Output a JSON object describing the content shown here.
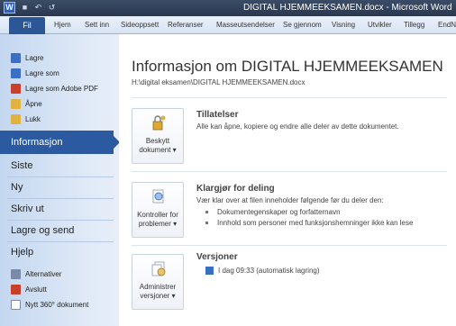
{
  "window": {
    "title": "DIGITAL HJEMMEEKSAMEN.docx - Microsoft Word",
    "logo": "W"
  },
  "quick_access": [
    {
      "icon": "save-icon",
      "glyph": "■"
    },
    {
      "icon": "undo-icon",
      "glyph": "↶"
    },
    {
      "icon": "redo-icon",
      "glyph": "↺"
    }
  ],
  "ribbon": {
    "file_tab": "Fil",
    "tabs": [
      "Hjem",
      "Sett inn",
      "Sideoppsett",
      "Referanser",
      "Masseutsendelser",
      "Se gjennom",
      "Visning",
      "Utvikler",
      "Tillegg",
      "EndN"
    ]
  },
  "sidebar": {
    "top_items": [
      {
        "label": "Lagre",
        "icon": "save-icon",
        "color": "#3a6fc2"
      },
      {
        "label": "Lagre som",
        "icon": "save-as-icon",
        "color": "#3a6fc2"
      },
      {
        "label": "Lagre som Adobe PDF",
        "icon": "pdf-icon",
        "color": "#c8402b"
      },
      {
        "label": "Åpne",
        "icon": "open-folder-icon",
        "color": "#e0b240"
      },
      {
        "label": "Lukk",
        "icon": "close-folder-icon",
        "color": "#e0b240"
      }
    ],
    "selected": "Informasjon",
    "main_items": [
      "Siste",
      "Ny",
      "Skriv ut",
      "Lagre og send",
      "Hjelp"
    ],
    "bottom_items": [
      {
        "label": "Alternativer",
        "icon": "options-icon",
        "color": "#7a8aa8"
      },
      {
        "label": "Avslutt",
        "icon": "exit-icon",
        "color": "#c8402b"
      },
      {
        "label": "Nytt 360° dokument",
        "icon": "document-icon",
        "color": "#ffffff"
      }
    ]
  },
  "content": {
    "title": "Informasjon om DIGITAL HJEMMEEKSAMEN",
    "path": "H:\\digital eksamen\\DIGITAL HJEMMEEKSAMEN.docx",
    "sections": [
      {
        "button": "Beskytt\ndokument ▾",
        "icon": "lock-key-icon",
        "heading": "Tillatelser",
        "text": "Alle kan åpne, kopiere og endre alle deler av dette dokumentet.",
        "bullets": []
      },
      {
        "button": "Kontroller for\nproblemer ▾",
        "icon": "inspect-icon",
        "heading": "Klargjør for deling",
        "text": "Vær klar over at filen inneholder følgende før du deler den:",
        "bullets": [
          "Dokumentegenskaper og forfatternavn",
          "Innhold som personer med funksjonshemninger ikke kan lese"
        ]
      },
      {
        "button": "Administrer\nversjoner ▾",
        "icon": "versions-icon",
        "heading": "Versjoner",
        "text": "I dag 09:33 (automatisk lagring)",
        "bullets": []
      }
    ]
  }
}
